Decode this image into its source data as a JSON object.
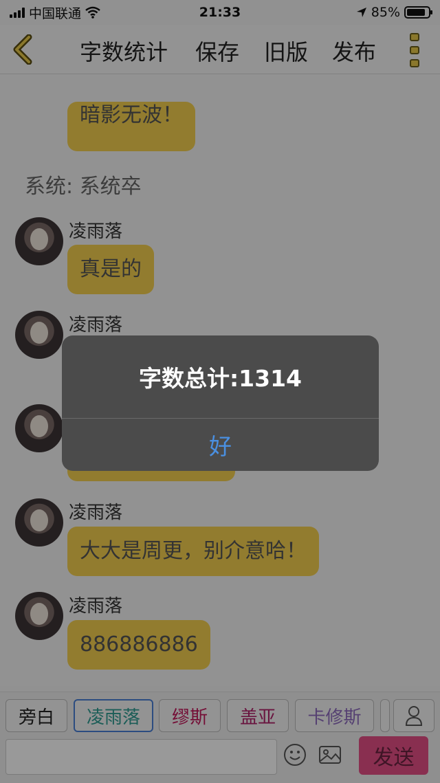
{
  "status_bar": {
    "carrier": "中国联通",
    "time": "21:33",
    "battery_percent": "85%"
  },
  "nav": {
    "items": [
      "字数统计",
      "保存",
      "旧版",
      "发布"
    ]
  },
  "chat": {
    "partial_bubble_text": "暗影无波！",
    "system_line": "系统:   系统卒",
    "messages": [
      {
        "sender": "凌雨落",
        "text": "真是的"
      },
      {
        "sender": "凌雨落",
        "text": ""
      },
      {
        "sender": "",
        "text": ""
      },
      {
        "sender": "凌雨落",
        "text": "大大是周更，别介意哈！"
      },
      {
        "sender": "凌雨落",
        "text": "886886886"
      }
    ]
  },
  "alert": {
    "message": "字数总计:1314",
    "ok_label": "好"
  },
  "bottom": {
    "characters": [
      "旁白",
      "凌雨落",
      "缪斯",
      "盖亚",
      "卡修斯"
    ],
    "send_label": "发送"
  },
  "colors": {
    "bubble": "#f3cf4f",
    "alert_background": "#4b4b4b",
    "alert_button": "#4a90e2",
    "send_button": "#e44f86",
    "chip_selected_border": "#4a7fd6",
    "chip_lingyuluo": "#2e9c92",
    "chip_miusi": "#c2185b",
    "chip_gaiya": "#b0226a",
    "chip_kaxiusi": "#8e6bbf"
  }
}
